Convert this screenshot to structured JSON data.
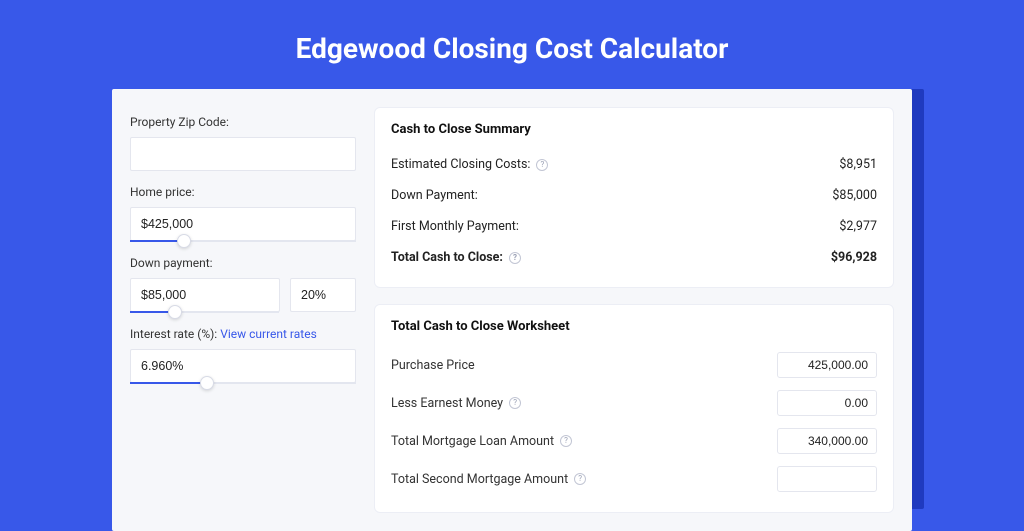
{
  "header": {
    "title": "Edgewood Closing Cost Calculator"
  },
  "form": {
    "zip": {
      "label": "Property Zip Code:",
      "value": ""
    },
    "home_price": {
      "label": "Home price:",
      "value": "$425,000",
      "slider_pct": 24
    },
    "down_payment": {
      "label": "Down payment:",
      "value": "$85,000",
      "pct_value": "20%",
      "slider_pct": 30
    },
    "interest_rate": {
      "label": "Interest rate (%):",
      "link_text": "View current rates",
      "value": "6.960%",
      "slider_pct": 34
    }
  },
  "summary": {
    "title": "Cash to Close Summary",
    "rows": [
      {
        "label": "Estimated Closing Costs:",
        "help": true,
        "value": "$8,951",
        "bold": false
      },
      {
        "label": "Down Payment:",
        "help": false,
        "value": "$85,000",
        "bold": false
      },
      {
        "label": "First Monthly Payment:",
        "help": false,
        "value": "$2,977",
        "bold": false
      },
      {
        "label": "Total Cash to Close:",
        "help": true,
        "value": "$96,928",
        "bold": true
      }
    ]
  },
  "worksheet": {
    "title": "Total Cash to Close Worksheet",
    "rows": [
      {
        "label": "Purchase Price",
        "help": false,
        "value": "425,000.00"
      },
      {
        "label": "Less Earnest Money",
        "help": true,
        "value": "0.00"
      },
      {
        "label": "Total Mortgage Loan Amount",
        "help": true,
        "value": "340,000.00"
      },
      {
        "label": "Total Second Mortgage Amount",
        "help": true,
        "value": ""
      }
    ]
  }
}
